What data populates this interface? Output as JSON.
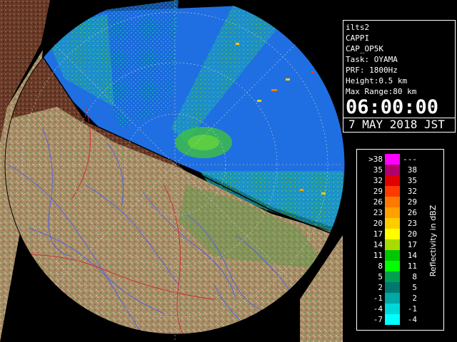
{
  "info": {
    "site": "ilts2",
    "product": "CAPPI",
    "scan": "CAP_OP5K",
    "task": "Task: OYAMA",
    "prf": "PRF: 1800Hz",
    "height": "Height:0.5 km",
    "max_range": "Max Range:80 km",
    "time": "06:00:00",
    "date": "7 MAY 2018 JST"
  },
  "legend": {
    "title": "Reflectivity in dBZ",
    "rows": [
      {
        "lo": ">38",
        "hi": "---",
        "color": "#ff00ff"
      },
      {
        "lo": "35",
        "hi": "38",
        "color": "#b0006a"
      },
      {
        "lo": "32",
        "hi": "35",
        "color": "#e00000"
      },
      {
        "lo": "29",
        "hi": "32",
        "color": "#ff3a00"
      },
      {
        "lo": "26",
        "hi": "29",
        "color": "#ff7a00"
      },
      {
        "lo": "23",
        "hi": "26",
        "color": "#ffa000"
      },
      {
        "lo": "20",
        "hi": "23",
        "color": "#ffcc00"
      },
      {
        "lo": "17",
        "hi": "20",
        "color": "#ffff00"
      },
      {
        "lo": "14",
        "hi": "17",
        "color": "#a8dc00"
      },
      {
        "lo": "11",
        "hi": "14",
        "color": "#00c800"
      },
      {
        "lo": "8",
        "hi": "11",
        "color": "#00ff00"
      },
      {
        "lo": "5",
        "hi": "8",
        "color": "#00a050"
      },
      {
        "lo": "2",
        "hi": "5",
        "color": "#007870"
      },
      {
        "lo": "-1",
        "hi": "2",
        "color": "#00a8a8"
      },
      {
        "lo": "-4",
        "hi": "-1",
        "color": "#00d8d8"
      },
      {
        "lo": "-7",
        "hi": "-4",
        "color": "#00ffff"
      }
    ]
  },
  "colors": {
    "sea": "#1e6fe0",
    "land_light": "#b09470",
    "land_dark": "#5a2e22",
    "river": "#5560e8",
    "boundary": "#cc3030",
    "range_ring": "#d0d0d0"
  }
}
